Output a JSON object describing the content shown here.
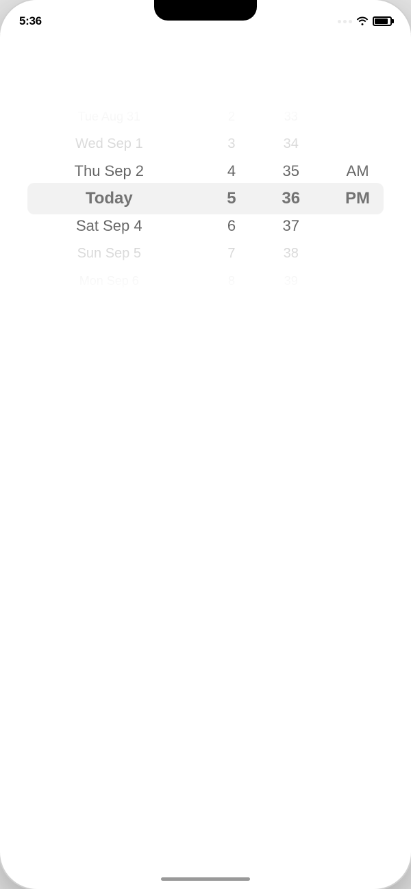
{
  "status_bar": {
    "time": "5:36",
    "signal": "...",
    "wifi": "wifi",
    "battery": "battery"
  },
  "picker": {
    "columns": {
      "date": {
        "items": [
          {
            "label": "Tue Aug 31",
            "state": "very-far"
          },
          {
            "label": "Wed Sep 1",
            "state": "far"
          },
          {
            "label": "Thu Sep 2",
            "state": "near"
          },
          {
            "label": "Today",
            "state": "selected"
          },
          {
            "label": "Sat Sep 4",
            "state": "near"
          },
          {
            "label": "Sun Sep 5",
            "state": "far"
          },
          {
            "label": "Mon Sep 6",
            "state": "very-far"
          }
        ]
      },
      "hour": {
        "items": [
          {
            "label": "2",
            "state": "very-far"
          },
          {
            "label": "3",
            "state": "far"
          },
          {
            "label": "4",
            "state": "near"
          },
          {
            "label": "5",
            "state": "selected"
          },
          {
            "label": "6",
            "state": "near"
          },
          {
            "label": "7",
            "state": "far"
          },
          {
            "label": "8",
            "state": "very-far"
          }
        ]
      },
      "minute": {
        "items": [
          {
            "label": "33",
            "state": "very-far"
          },
          {
            "label": "34",
            "state": "far"
          },
          {
            "label": "35",
            "state": "near"
          },
          {
            "label": "36",
            "state": "selected"
          },
          {
            "label": "37",
            "state": "near"
          },
          {
            "label": "38",
            "state": "far"
          },
          {
            "label": "39",
            "state": "very-far"
          }
        ]
      },
      "ampm": {
        "items": [
          {
            "label": "",
            "state": "very-far"
          },
          {
            "label": "",
            "state": "far"
          },
          {
            "label": "AM",
            "state": "near"
          },
          {
            "label": "PM",
            "state": "selected"
          },
          {
            "label": "",
            "state": "near"
          },
          {
            "label": "",
            "state": "far"
          },
          {
            "label": "",
            "state": "very-far"
          }
        ]
      }
    }
  }
}
